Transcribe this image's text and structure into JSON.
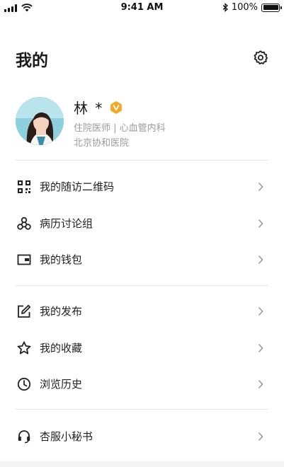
{
  "status_bar": {
    "time": "9:41 AM",
    "battery": "100%"
  },
  "header": {
    "title": "我的"
  },
  "profile": {
    "name": "林 *",
    "title": "住院医师 | 心血管内科",
    "hospital": "北京协和医院"
  },
  "menu": {
    "qr_code": "我的随访二维码",
    "case_group": "病历讨论组",
    "wallet": "我的钱包",
    "posts": "我的发布",
    "favorites": "我的收藏",
    "history": "浏览历史",
    "service": "杏服小秘书"
  },
  "colors": {
    "accent_badge": "#f5a623",
    "icon": "#222222",
    "subtext": "#9a9a9a"
  }
}
